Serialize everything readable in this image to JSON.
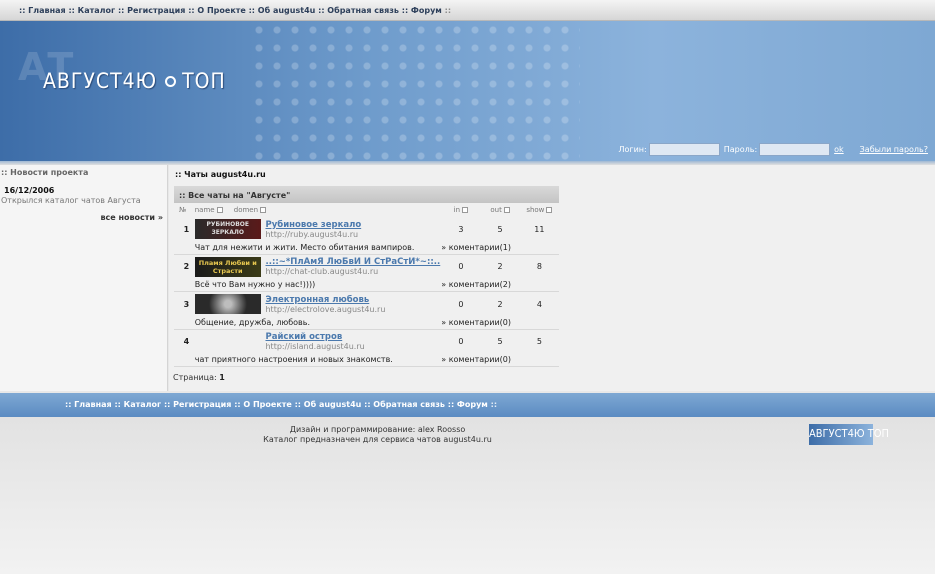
{
  "topnav": [
    ":: Главная",
    ":: Каталог",
    ":: Регистрация",
    ":: О Проекте",
    ":: Об august4u",
    ":: Обратная связь",
    ":: Форум",
    "::"
  ],
  "header": {
    "logo_left": "АВГУСТ4Ю",
    "logo_right": "ТОП",
    "ghost": "АТ"
  },
  "login": {
    "login_label": "Логин:",
    "password_label": "Пароль:",
    "ok": "ok",
    "forgot": "Забыли пароль?"
  },
  "sidebar": {
    "title": ":: Новости проекта",
    "date": "16/12/2006",
    "text": "Открылся каталог чатов Августа",
    "more": "все новости »"
  },
  "main": {
    "title": ":: Чаты august4u.ru",
    "panel_title": ":: Все чаты на \"Августе\"",
    "columns": {
      "no": "№",
      "name": "name",
      "domen": "domen",
      "in": "in",
      "out": "out",
      "show": "show"
    },
    "rows": [
      {
        "num": "1",
        "thumb": "РУБИНОВОЕ ЗЕРКАЛО",
        "title": "Рубиновое зеркало",
        "url": "http://ruby.august4u.ru",
        "in": "3",
        "out": "5",
        "show": "11",
        "desc": "Чат для нежити и жити. Место обитания вампиров.",
        "comments": "коментарии(1)"
      },
      {
        "num": "2",
        "thumb": "Пламя Любви и Страсти",
        "title": "..::~*ПлАмЯ ЛюБвИ И СтРаСтИ*~::..",
        "url": "http://chat-club.august4u.ru",
        "in": "0",
        "out": "2",
        "show": "8",
        "desc": "Всё что Вам нужно у нас!))))",
        "comments": "коментарии(2)"
      },
      {
        "num": "3",
        "thumb": "",
        "title": "Электронная любовь",
        "url": "http://electrolove.august4u.ru",
        "in": "0",
        "out": "2",
        "show": "4",
        "desc": "Общение, дружба, любовь.",
        "comments": "коментарии(0)"
      },
      {
        "num": "4",
        "thumb": "",
        "title": "Райский остров",
        "url": "http://island.august4u.ru",
        "in": "0",
        "out": "5",
        "show": "5",
        "desc": "чат приятного настроения и новых знакомств.",
        "comments": "коментарии(0)"
      }
    ],
    "pager_label": "Страница:",
    "pager_page": "1"
  },
  "footnav": [
    ":: Главная",
    ":: Каталог",
    ":: Регистрация",
    ":: О Проекте",
    ":: Об august4u",
    ":: Обратная связь",
    ":: Форум",
    "::"
  ],
  "footer": {
    "design_label": "Дизайн и программирование:",
    "design_author": "alex Roosso",
    "catalog_label": "Каталог предназначен для сервиса чатов",
    "catalog_link": "august4u.ru",
    "logo_left": "АВГУСТ4Ю",
    "logo_right": "ТОП"
  },
  "colors": {
    "accent": "#5b8bc2",
    "link": "#4b79ad",
    "header_dark": "#3d6da8"
  }
}
